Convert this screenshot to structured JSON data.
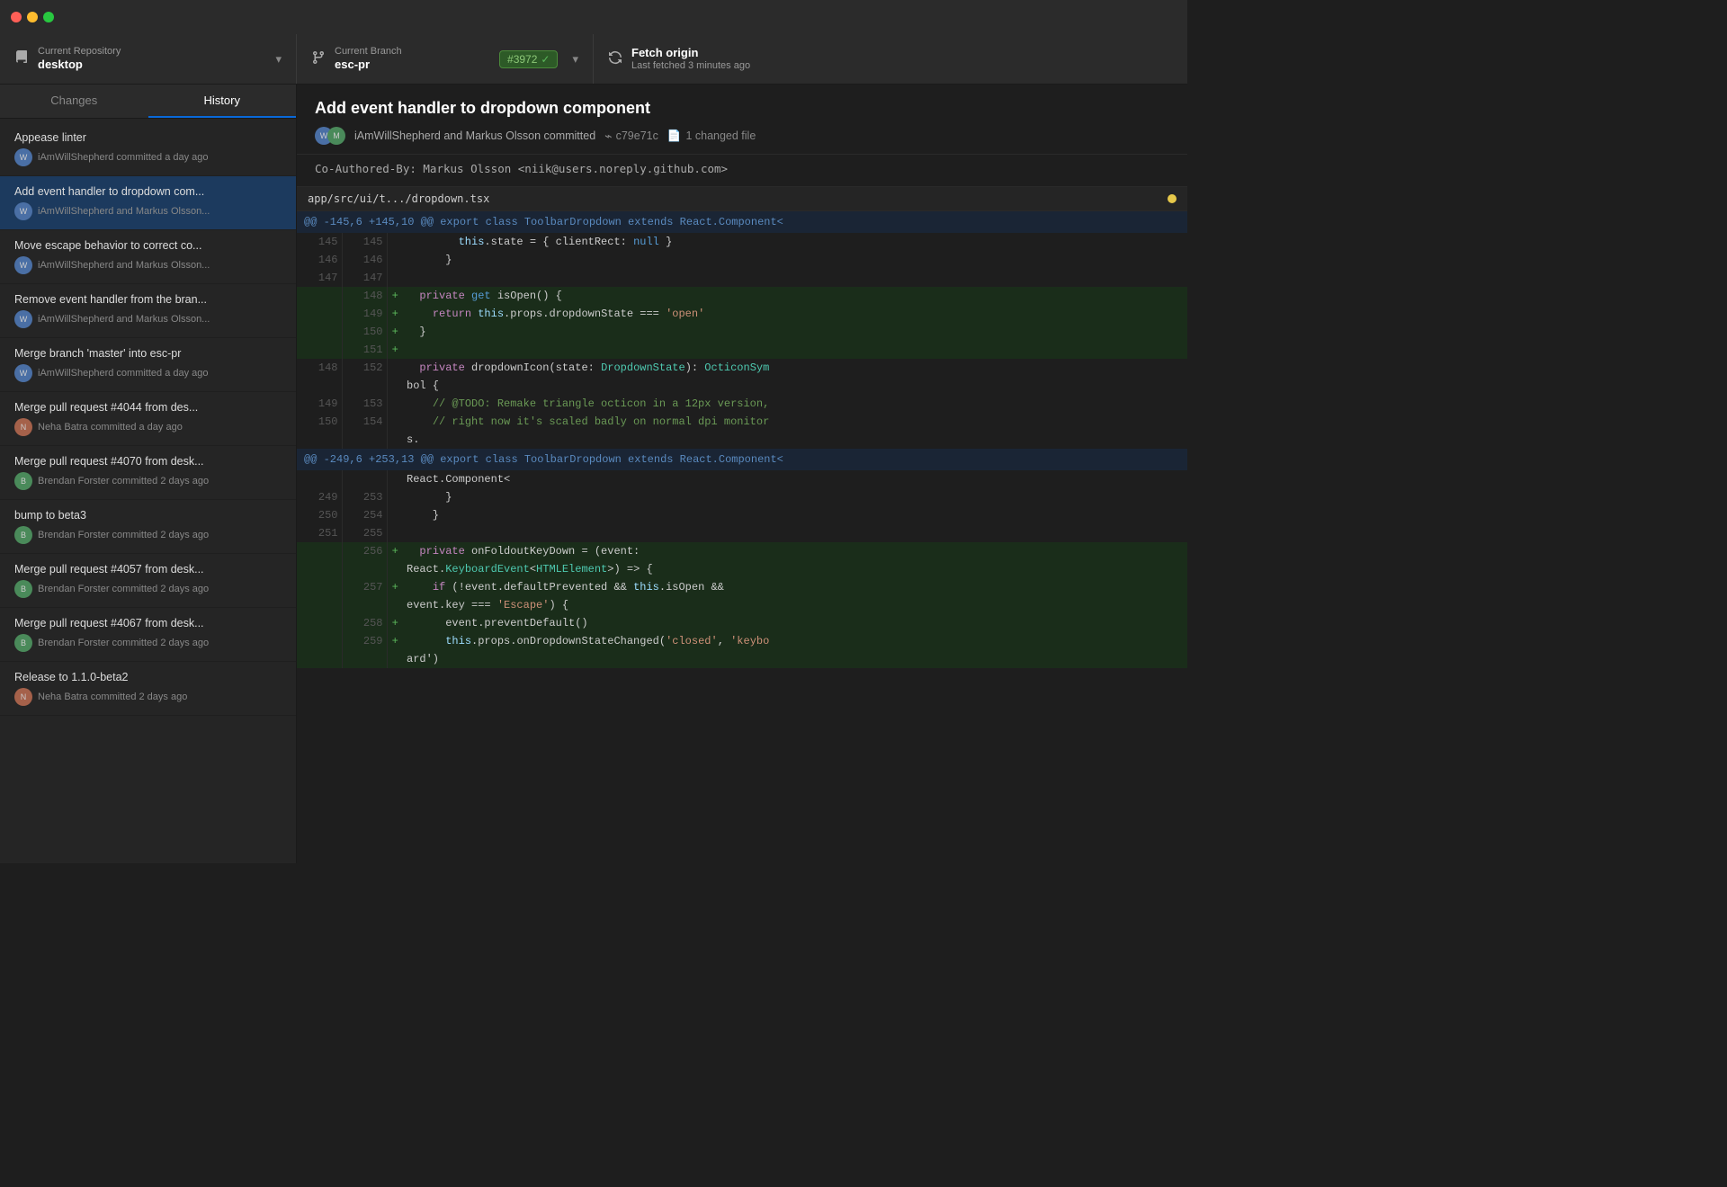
{
  "titlebar": {
    "traffic": [
      "red",
      "yellow",
      "green"
    ]
  },
  "toolbar": {
    "repo_label": "Current Repository",
    "repo_name": "desktop",
    "branch_label": "Current Branch",
    "branch_name": "esc-pr",
    "branch_badge": "#3972",
    "fetch_label": "Fetch origin",
    "fetch_sub": "Last fetched 3 minutes ago"
  },
  "sidebar": {
    "tab_changes": "Changes",
    "tab_history": "History",
    "commits": [
      {
        "title": "Appease linter",
        "author": "iAmWillShepherd committed a day ago",
        "avatar_type": "will"
      },
      {
        "title": "Add event handler to dropdown com...",
        "author": "iAmWillShepherd and Markus Olsson...",
        "avatar_type": "will",
        "selected": true
      },
      {
        "title": "Move escape behavior to correct co...",
        "author": "iAmWillShepherd and Markus Olsson...",
        "avatar_type": "will"
      },
      {
        "title": "Remove event handler from the bran...",
        "author": "iAmWillShepherd and Markus Olsson...",
        "avatar_type": "will"
      },
      {
        "title": "Merge branch 'master' into esc-pr",
        "author": "iAmWillShepherd committed a day ago",
        "avatar_type": "will"
      },
      {
        "title": "Merge pull request #4044 from des...",
        "author": "Neha Batra committed a day ago",
        "avatar_type": "neha"
      },
      {
        "title": "Merge pull request #4070 from desk...",
        "author": "Brendan Forster committed 2 days ago",
        "avatar_type": "brendan"
      },
      {
        "title": "bump to beta3",
        "author": "Brendan Forster committed 2 days ago",
        "avatar_type": "brendan"
      },
      {
        "title": "Merge pull request #4057 from desk...",
        "author": "Brendan Forster committed 2 days ago",
        "avatar_type": "brendan"
      },
      {
        "title": "Merge pull request #4067 from desk...",
        "author": "Brendan Forster committed 2 days ago",
        "avatar_type": "brendan"
      },
      {
        "title": "Release to 1.1.0-beta2",
        "author": "Neha Batra committed 2 days ago",
        "avatar_type": "neha"
      }
    ]
  },
  "main": {
    "commit_title": "Add event handler to dropdown component",
    "commit_authors": "iAmWillShepherd and Markus Olsson committed",
    "commit_sha": "c79e71c",
    "changed_files": "1 changed file",
    "commit_message": "Co-Authored-By: Markus Olsson <niik@users.noreply.github.com>",
    "file_path": "app/src/ui/t.../dropdown.tsx"
  }
}
